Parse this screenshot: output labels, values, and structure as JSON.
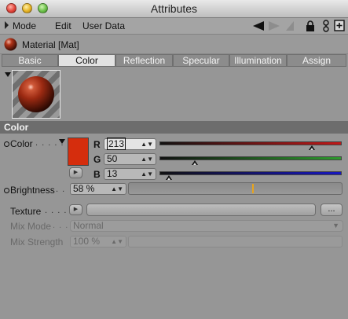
{
  "window": {
    "title": "Attributes"
  },
  "menu": [
    "Mode",
    "Edit",
    "User Data"
  ],
  "toolbar_icons": [
    "back-arrow-icon",
    "forward-arrow-icon",
    "up-arrow-icon",
    "lock-icon",
    "node-icon",
    "new-panel-icon"
  ],
  "material": {
    "label": "Material [Mat]"
  },
  "tabs": [
    {
      "label": "Basic",
      "active": false
    },
    {
      "label": "Color",
      "active": true
    },
    {
      "label": "Reflection",
      "active": false
    },
    {
      "label": "Specular",
      "active": false
    },
    {
      "label": "Illumination",
      "active": false
    },
    {
      "label": "Assign",
      "active": false
    }
  ],
  "section": {
    "title": "Color"
  },
  "color": {
    "label": "Color",
    "swatch": "#d52d0d",
    "channels": [
      {
        "name": "R",
        "value": "213",
        "fraction": 0.835,
        "bar": "#c01818"
      },
      {
        "name": "G",
        "value": "50",
        "fraction": 0.196,
        "bar": "#2e9a2e"
      },
      {
        "name": "B",
        "value": "13",
        "fraction": 0.051,
        "bar": "#1616c0"
      }
    ]
  },
  "brightness": {
    "label": "Brightness",
    "value": "58 %",
    "fraction": 0.58
  },
  "texture": {
    "label": "Texture",
    "browse_label": "..."
  },
  "mix_mode": {
    "label": "Mix Mode",
    "value": "Normal"
  },
  "mix_strength": {
    "label": "Mix Strength",
    "value": "100 %"
  }
}
